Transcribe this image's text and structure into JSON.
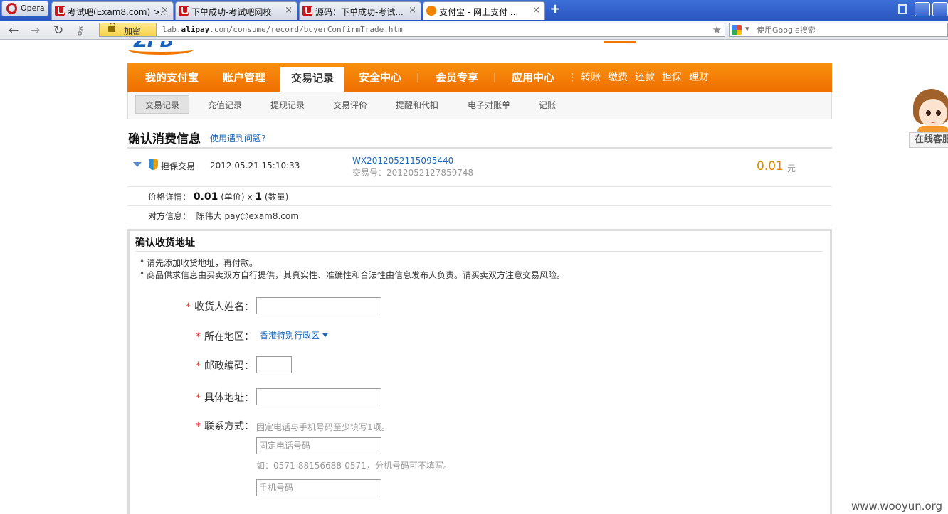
{
  "browser": {
    "opera_label": "Opera",
    "tabs": [
      {
        "title": "考试吧(Exam8.com) >..."
      },
      {
        "title": "下单成功-考试吧网校"
      },
      {
        "title": "源码：下单成功-考试..."
      },
      {
        "title": "支付宝 - 网上支付 ..."
      }
    ],
    "close_glyph": "×",
    "new_tab_glyph": "+",
    "back_glyph": "←",
    "forward_glyph": "→",
    "reload_glyph": "↻",
    "key_glyph": "⚷",
    "secure_label": "加密",
    "url_prefix": "lab.",
    "url_domain": "alipay",
    "url_rest": ".com/consume/record/buyerConfirmTrade.htm",
    "star_glyph": "★",
    "search_dropdown_glyph": "▾",
    "search_placeholder": "使用Google搜索"
  },
  "main_nav": {
    "items": [
      "我的支付宝",
      "账户管理",
      "交易记录",
      "安全中心",
      "会员专享",
      "应用中心"
    ],
    "separator": "|",
    "dots": "⋮",
    "quick_links": [
      "转账",
      "缴费",
      "还款",
      "担保",
      "理财"
    ]
  },
  "sub_nav": {
    "items": [
      "交易记录",
      "充值记录",
      "提现记录",
      "交易评价",
      "提醒和代扣",
      "电子对账单",
      "记账"
    ]
  },
  "header": {
    "title": "确认消费信息",
    "help_link": "使用遇到问题?"
  },
  "trade": {
    "type": "担保交易",
    "time": "2012.05.21 15:10:33",
    "order_no": "WX2012052115095440",
    "trade_no": "交易号：2012052127859748",
    "amount": "0.01",
    "unit": "元"
  },
  "price": {
    "label": "价格详情：",
    "unit_price": "0.01",
    "unit_price_note": "(单价) x",
    "quantity": "1",
    "quantity_note": "(数量)"
  },
  "counterparty": {
    "label": "对方信息：",
    "value": "陈伟大 pay@exam8.com"
  },
  "address_form": {
    "title": "确认收货地址",
    "notes": [
      "请先添加收货地址，再付款。",
      "商品供求信息由买卖双方自行提供，其真实性、准确性和合法性由信息发布人负责。请买卖双方注意交易风险。"
    ],
    "required_mark": "*",
    "receiver_label": "收货人姓名：",
    "region_label": "所在地区：",
    "region_value": "香港特别行政区",
    "zip_label": "邮政编码：",
    "street_label": "具体地址：",
    "contact_label": "联系方式：",
    "contact_hint": "固定电话与手机号码至少填写1项。",
    "phone_placeholder": "固定电话号码",
    "phone_hint": "如：0571-88156688-0571，分机号码可不填写。",
    "mobile_placeholder": "手机号码"
  },
  "service": {
    "label": "在线客服"
  },
  "watermark": "www.wooyun.org",
  "colors": {
    "nav_orange": "#f07800",
    "link_blue": "#1a66b3",
    "amount_orange": "#e08700",
    "required_red": "#e4393c"
  }
}
